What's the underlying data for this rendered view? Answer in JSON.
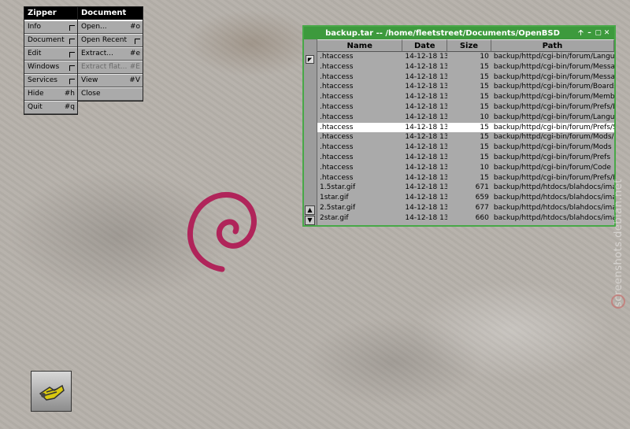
{
  "menus": {
    "zipper": {
      "title": "Zipper",
      "items": [
        {
          "label": "Info",
          "shortcut": ""
        },
        {
          "label": "Document",
          "shortcut": ""
        },
        {
          "label": "Edit",
          "shortcut": ""
        },
        {
          "label": "Windows",
          "shortcut": ""
        },
        {
          "label": "Services",
          "shortcut": ""
        },
        {
          "label": "Hide",
          "shortcut": "#h"
        },
        {
          "label": "Quit",
          "shortcut": "#q"
        }
      ]
    },
    "document": {
      "title": "Document",
      "items": [
        {
          "label": "Open...",
          "shortcut": "#o"
        },
        {
          "label": "Open Recent",
          "shortcut": ""
        },
        {
          "label": "Extract...",
          "shortcut": "#e"
        },
        {
          "label": "Extract flat...",
          "shortcut": "#E"
        },
        {
          "label": "View",
          "shortcut": "#V"
        },
        {
          "label": "Close",
          "shortcut": ""
        }
      ]
    }
  },
  "window": {
    "title": "backup.tar  --  /home/fleetstreet/Documents/OpenBSD",
    "controls": {
      "pin": "🡡",
      "minimize": "–",
      "maximize": "▢",
      "close": "✕"
    },
    "columns": {
      "name": "Name",
      "date": "Date",
      "size": "Size",
      "path": "Path"
    },
    "rows": [
      {
        "name": ".htaccess",
        "date": "14-12-18 13",
        "size": "10",
        "path": "backup/httpd/cgi-bin/forum/Langua"
      },
      {
        "name": ".htaccess",
        "date": "14-12-18 13",
        "size": "15",
        "path": "backup/httpd/cgi-bin/forum/Messag"
      },
      {
        "name": ".htaccess",
        "date": "14-12-18 13",
        "size": "15",
        "path": "backup/httpd/cgi-bin/forum/Messag"
      },
      {
        "name": ".htaccess",
        "date": "14-12-18 13",
        "size": "15",
        "path": "backup/httpd/cgi-bin/forum/Boards"
      },
      {
        "name": ".htaccess",
        "date": "14-12-18 13",
        "size": "15",
        "path": "backup/httpd/cgi-bin/forum/Membe"
      },
      {
        "name": ".htaccess",
        "date": "14-12-18 13",
        "size": "15",
        "path": "backup/httpd/cgi-bin/forum/Prefs/B"
      },
      {
        "name": ".htaccess",
        "date": "14-12-18 13",
        "size": "10",
        "path": "backup/httpd/cgi-bin/forum/Langua"
      },
      {
        "name": ".htaccess",
        "date": "14-12-18 13",
        "size": "15",
        "path": "backup/httpd/cgi-bin/forum/Prefs/S"
      },
      {
        "name": ".htaccess",
        "date": "14-12-18 13",
        "size": "15",
        "path": "backup/httpd/cgi-bin/forum/Mods/M"
      },
      {
        "name": ".htaccess",
        "date": "14-12-18 13",
        "size": "15",
        "path": "backup/httpd/cgi-bin/forum/Mods"
      },
      {
        "name": ".htaccess",
        "date": "14-12-18 13",
        "size": "15",
        "path": "backup/httpd/cgi-bin/forum/Prefs"
      },
      {
        "name": ".htaccess",
        "date": "14-12-18 13",
        "size": "10",
        "path": "backup/httpd/cgi-bin/forum/Code"
      },
      {
        "name": ".htaccess",
        "date": "14-12-18 13",
        "size": "15",
        "path": "backup/httpd/cgi-bin/forum/Prefs/H"
      },
      {
        "name": "1.5star.gif",
        "date": "14-12-18 13",
        "size": "671",
        "path": "backup/httpd/htdocs/blahdocs/ima"
      },
      {
        "name": "1star.gif",
        "date": "14-12-18 13",
        "size": "659",
        "path": "backup/httpd/htdocs/blahdocs/ima"
      },
      {
        "name": "2.5star.gif",
        "date": "14-12-18 13",
        "size": "677",
        "path": "backup/httpd/htdocs/blahdocs/ima"
      },
      {
        "name": "2star.gif",
        "date": "14-12-18 13",
        "size": "660",
        "path": "backup/httpd/htdocs/blahdocs/ima"
      }
    ],
    "selected_row": 7
  },
  "dock": {
    "icon": "zipper-app-icon"
  },
  "watermark": "screenshots.debian.net",
  "colors": {
    "titlebar": "#3d9a3d",
    "swirl": "#b0245a"
  }
}
